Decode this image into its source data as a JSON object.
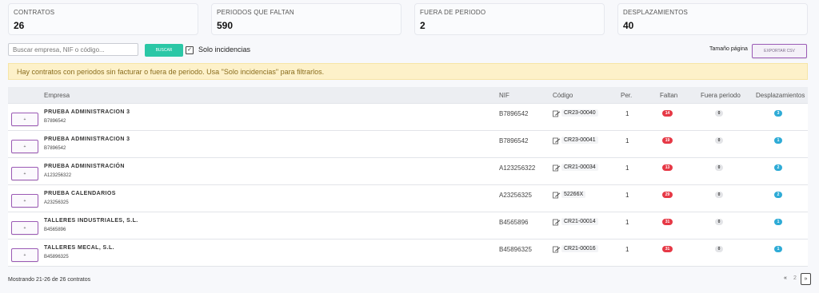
{
  "stats": [
    {
      "label": "CONTRATOS",
      "value": "26"
    },
    {
      "label": "PERIODOS QUE FALTAN",
      "value": "590"
    },
    {
      "label": "FUERA DE PERIODO",
      "value": "2"
    },
    {
      "label": "DESPLAZAMIENTOS",
      "value": "40"
    }
  ],
  "toolbar": {
    "search_placeholder": "Buscar empresa, NIF o código...",
    "search_button": "BUSCAR",
    "checkbox_mark": "✓",
    "checkbox_label": "Solo incidencias",
    "page_size_label": "Tamaño página",
    "export_button": "EXPORTAR CSV"
  },
  "alert": "Hay contratos con periodos sin facturar o fuera de periodo. Usa \"Solo incidencias\" para filtrarlos.",
  "table": {
    "headers": {
      "empresa": "Empresa",
      "nif": "NIF",
      "codigo": "Código",
      "per": "Per.",
      "faltan": "Faltan",
      "fuera": "Fuera periodo",
      "desp": "Desplazamientos"
    },
    "select_label": "+",
    "rows": [
      {
        "name": "PRUEBA ADMINISTRACION 3",
        "nif_sub": "B7896542",
        "nif": "B7896542",
        "code": "CR23-00040",
        "per": "1",
        "faltan": "14",
        "fuera": "0",
        "desp": "3"
      },
      {
        "name": "PRUEBA ADMINISTRACION 3",
        "nif_sub": "B7896542",
        "nif": "B7896542",
        "code": "CR23-00041",
        "per": "1",
        "faltan": "19",
        "fuera": "0",
        "desp": "1"
      },
      {
        "name": "PRUEBA ADMINISTRACIÓN",
        "nif_sub": "A123256322",
        "nif": "A123256322",
        "code": "CR21-00034",
        "per": "1",
        "faltan": "13",
        "fuera": "0",
        "desp": "2"
      },
      {
        "name": "PRUEBA CALENDARIOS",
        "nif_sub": "A23256325",
        "nif": "A23256325",
        "code": "52266X",
        "per": "1",
        "faltan": "29",
        "fuera": "0",
        "desp": "2"
      },
      {
        "name": "TALLERES INDUSTRIALES, S.L.",
        "nif_sub": "B4565896",
        "nif": "B4565896",
        "code": "CR21-00014",
        "per": "1",
        "faltan": "31",
        "fuera": "0",
        "desp": "1"
      },
      {
        "name": "TALLERES MECAL, S.L.",
        "nif_sub": "B45896325",
        "nif": "B45896325",
        "code": "CR21-00016",
        "per": "1",
        "faltan": "31",
        "fuera": "0",
        "desp": "1"
      }
    ]
  },
  "footer": {
    "showing": "Mostrando 21-26 de 26 contratos",
    "pager": {
      "prev": "«",
      "current": "2",
      "next": "»"
    }
  },
  "colors": {
    "accent": "#2bc7a6",
    "export_border": "#9b5ab5",
    "badge_red": "#e63946",
    "badge_blue": "#2eabd6"
  }
}
